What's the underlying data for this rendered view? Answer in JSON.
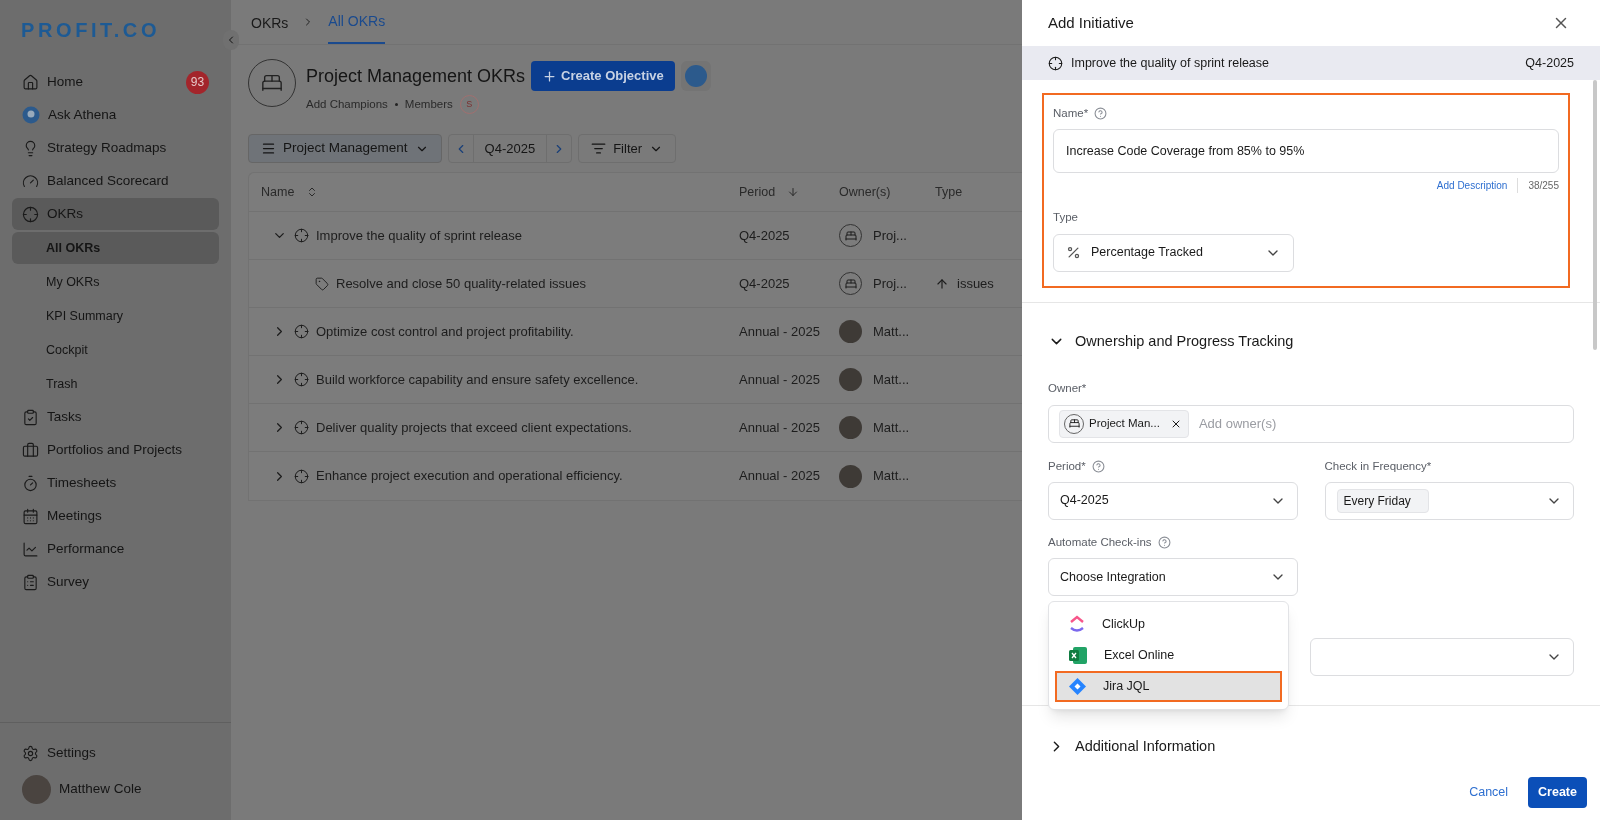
{
  "logo": "PROFIT.CO",
  "sidebar": {
    "items": [
      {
        "label": "Home",
        "badge": "93",
        "selected": false
      },
      {
        "label": "Ask Athena",
        "selected": false
      },
      {
        "label": "Strategy Roadmaps",
        "selected": false
      },
      {
        "label": "Balanced Scorecard",
        "selected": false
      },
      {
        "label": "OKRs",
        "selected": true,
        "children": [
          {
            "label": "All OKRs",
            "selected": true
          },
          {
            "label": "My OKRs",
            "selected": false
          },
          {
            "label": "KPI Summary",
            "selected": false
          },
          {
            "label": "Cockpit",
            "selected": false
          },
          {
            "label": "Trash",
            "selected": false
          }
        ]
      },
      {
        "label": "Tasks",
        "selected": false
      },
      {
        "label": "Portfolios and Projects",
        "selected": false
      },
      {
        "label": "Timesheets",
        "selected": false
      },
      {
        "label": "Meetings",
        "selected": false
      },
      {
        "label": "Performance",
        "selected": false
      },
      {
        "label": "Survey",
        "selected": false
      }
    ],
    "settings": "Settings",
    "user": "Matthew Cole"
  },
  "breadcrumb": [
    {
      "label": "OKRs",
      "selected": false
    },
    {
      "label": "All OKRs",
      "selected": true
    }
  ],
  "header": {
    "title": "Project Management OKRs",
    "create_button": "Create Objective",
    "add_champions": "Add Champions",
    "members": "Members",
    "member_initial": "S"
  },
  "toolbar": {
    "group": "Project Management",
    "period": "Q4-2025",
    "filter": "Filter"
  },
  "table": {
    "columns": [
      "Name",
      "Period",
      "Owner(s)",
      "Type"
    ],
    "rows": [
      {
        "kind": "objective",
        "expanded": true,
        "name": "Improve the quality of sprint release",
        "period": "Q4-2025",
        "owner": {
          "kind": "team",
          "label": "Proj..."
        }
      },
      {
        "kind": "key_result",
        "name": "Resolve and close 50 quality-related issues",
        "period": "Q4-2025",
        "owner": {
          "kind": "team",
          "label": "Proj..."
        },
        "type": "issues"
      },
      {
        "kind": "objective",
        "expanded": false,
        "name": "Optimize cost control and project profitability.",
        "period": "Annual - 2025",
        "owner": {
          "kind": "person",
          "label": "Matt..."
        }
      },
      {
        "kind": "objective",
        "expanded": false,
        "name": "Build workforce capability and ensure safety excellence.",
        "period": "Annual - 2025",
        "owner": {
          "kind": "person",
          "label": "Matt..."
        }
      },
      {
        "kind": "objective",
        "expanded": false,
        "name": "Deliver quality projects that exceed client expectations.",
        "period": "Annual - 2025",
        "owner": {
          "kind": "person",
          "label": "Matt..."
        }
      },
      {
        "kind": "objective",
        "expanded": false,
        "name": "Enhance project execution and operational efficiency.",
        "period": "Annual - 2025",
        "owner": {
          "kind": "person",
          "label": "Matt..."
        }
      }
    ]
  },
  "drawer": {
    "title": "Add Initiative",
    "objective": {
      "name": "Improve the quality of sprint release",
      "period": "Q4-2025"
    },
    "basics": {
      "highlighted": true,
      "name_label": "Name*",
      "name_value": "Increase Code Coverage from 85% to 95%",
      "add_description": "Add Description",
      "counter": "38/255",
      "type_label": "Type",
      "type_value": "Percentage Tracked"
    },
    "ownership": {
      "title": "Ownership and Progress Tracking",
      "expanded": true,
      "owner_label": "Owner*",
      "owner_chip": "Project Man...",
      "owner_placeholder": "Add owner(s)",
      "period_label": "Period*",
      "period_value": "Q4-2025",
      "frequency_label": "Check in Frequency*",
      "frequency_value": "Every Friday",
      "automate_label": "Automate Check-ins",
      "automate_value": "Choose Integration",
      "options": [
        {
          "label": "ClickUp",
          "selected": false
        },
        {
          "label": "Excel Online",
          "selected": false
        },
        {
          "label": "Jira JQL",
          "selected": true
        }
      ]
    },
    "additional": {
      "title": "Additional Information",
      "expanded": false
    },
    "cancel": "Cancel",
    "create": "Create"
  }
}
